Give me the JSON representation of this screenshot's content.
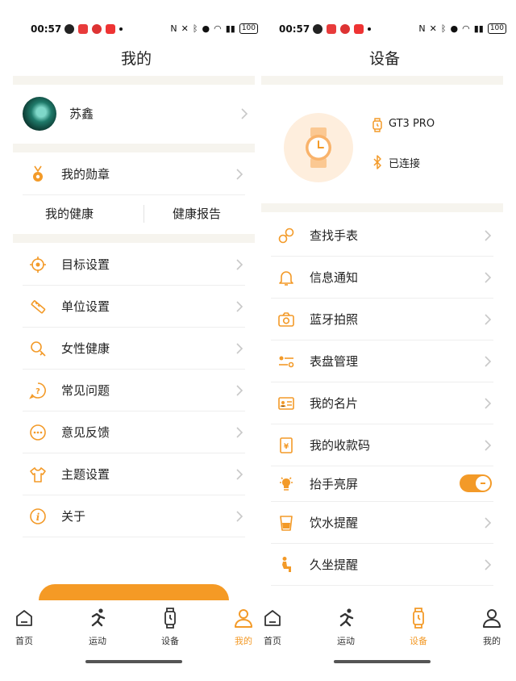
{
  "status_bar": {
    "time": "00:57",
    "battery": "100"
  },
  "left": {
    "title": "我的",
    "profile": {
      "name": "苏鑫"
    },
    "medal_label": "我的勋章",
    "health": {
      "my_health": "我的健康",
      "report": "健康报告"
    },
    "menu": [
      {
        "label": "目标设置",
        "icon": "target-icon"
      },
      {
        "label": "单位设置",
        "icon": "ruler-icon"
      },
      {
        "label": "女性健康",
        "icon": "female-icon"
      },
      {
        "label": "常见问题",
        "icon": "question-icon"
      },
      {
        "label": "意见反馈",
        "icon": "feedback-icon"
      },
      {
        "label": "主题设置",
        "icon": "shirt-icon"
      },
      {
        "label": "关于",
        "icon": "info-icon"
      }
    ],
    "tabs": [
      {
        "label": "首页",
        "icon": "home-icon"
      },
      {
        "label": "运动",
        "icon": "run-icon"
      },
      {
        "label": "设备",
        "icon": "watch-icon"
      },
      {
        "label": "我的",
        "icon": "person-icon",
        "active": true
      }
    ]
  },
  "right": {
    "title": "设备",
    "device": {
      "name": "GT3 PRO",
      "status": "已连接"
    },
    "menu": [
      {
        "label": "查找手表",
        "icon": "find-watch-icon"
      },
      {
        "label": "信息通知",
        "icon": "bell-icon"
      },
      {
        "label": "蓝牙拍照",
        "icon": "camera-icon"
      },
      {
        "label": "表盘管理",
        "icon": "sliders-icon"
      },
      {
        "label": "我的名片",
        "icon": "card-icon"
      },
      {
        "label": "我的收款码",
        "icon": "payment-icon"
      },
      {
        "label": "抬手亮屏",
        "icon": "bulb-icon",
        "toggle": true
      },
      {
        "label": "饮水提醒",
        "icon": "cup-icon"
      },
      {
        "label": "久坐提醒",
        "icon": "sitting-icon"
      }
    ],
    "tabs": [
      {
        "label": "首页",
        "icon": "home-icon"
      },
      {
        "label": "运动",
        "icon": "run-icon"
      },
      {
        "label": "设备",
        "icon": "watch-icon",
        "active": true
      },
      {
        "label": "我的",
        "icon": "person-icon"
      }
    ]
  },
  "colors": {
    "accent": "#f39a28",
    "separator": "#f6f4ee",
    "icon_bg": "#feeedd"
  }
}
